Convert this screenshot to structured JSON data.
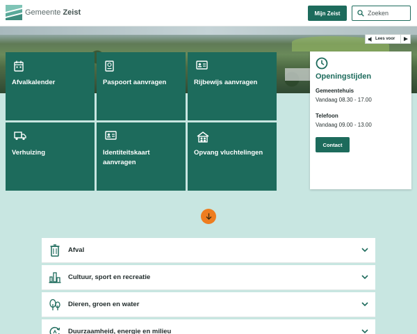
{
  "header": {
    "logo_prefix": "Gemeente",
    "logo_name": "Zeist",
    "mijn_zeist_label": "Mijn Zeist",
    "search_placeholder": "Zoeken"
  },
  "readspeaker": {
    "label": "Lees voor"
  },
  "tiles": [
    {
      "label": "Afvalkalender",
      "icon": "calendar-icon"
    },
    {
      "label": "Paspoort aanvragen",
      "icon": "passport-icon"
    },
    {
      "label": "Rijbewijs aanvragen",
      "icon": "id-card-icon"
    },
    {
      "label": "Verhuizing",
      "icon": "moving-truck-icon"
    },
    {
      "label": "Identiteitskaart aanvragen",
      "icon": "id-card-icon"
    },
    {
      "label": "Opvang vluchtelingen",
      "icon": "shelter-icon"
    }
  ],
  "opening_hours": {
    "title": "Openingstijden",
    "office_label": "Gemeentehuis",
    "office_hours": "Vandaag 08.30 - 17.00",
    "phone_label": "Telefoon",
    "phone_hours": "Vandaag 09.00 - 13.00",
    "contact_label": "Contact"
  },
  "topics": [
    {
      "label": "Afval",
      "icon": "bin-icon"
    },
    {
      "label": "Cultuur, sport en recreatie",
      "icon": "culture-icon"
    },
    {
      "label": "Dieren, groen en water",
      "icon": "tree-icon"
    },
    {
      "label": "Duurzaamheid, energie en milieu",
      "icon": "recycle-icon"
    }
  ],
  "colors": {
    "primary": "#1d6b5c",
    "accent": "#ee7d1f",
    "background": "#c8e6e1"
  }
}
